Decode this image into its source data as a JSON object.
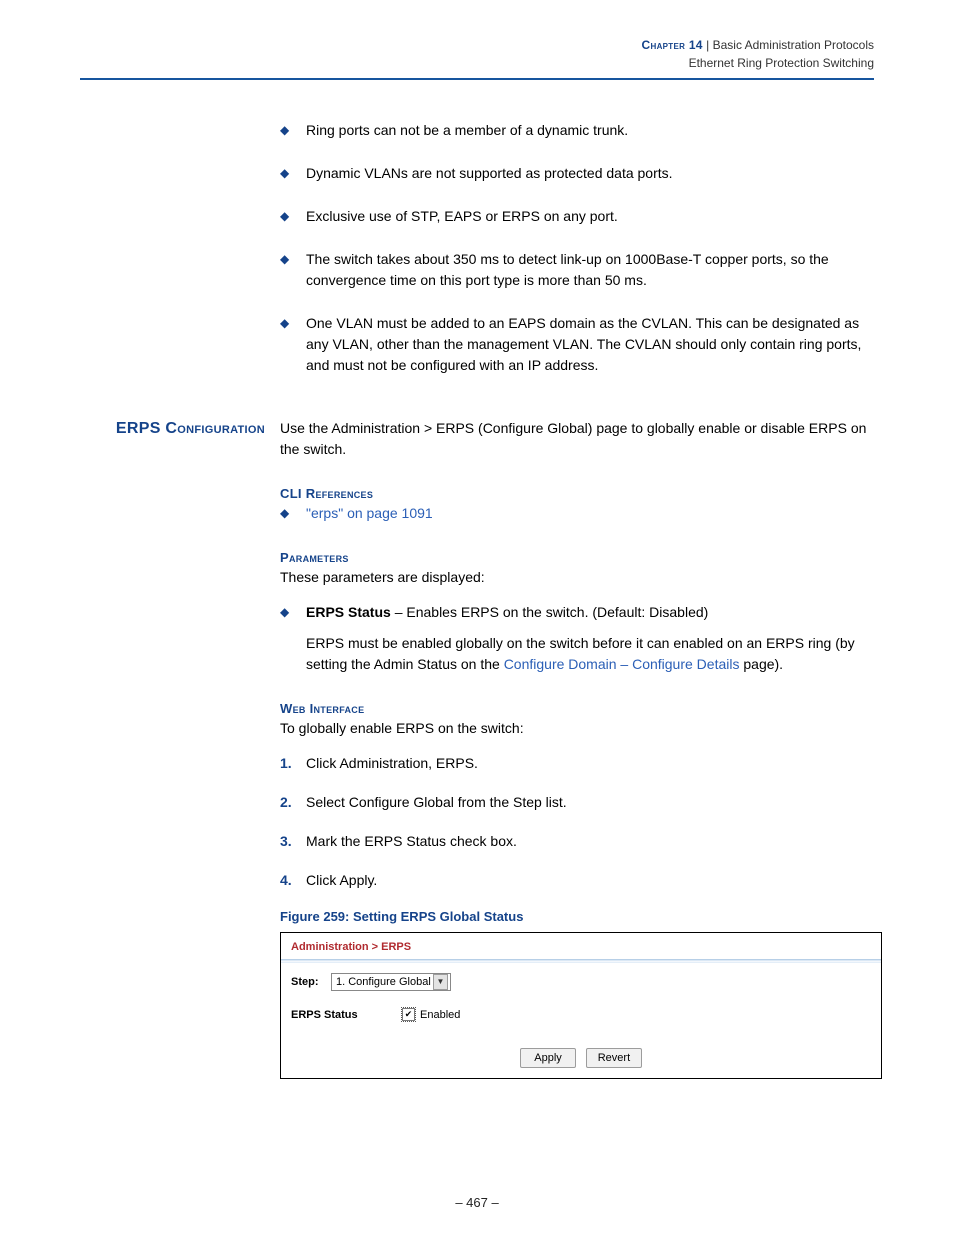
{
  "header": {
    "chapter": "Chapter 14",
    "sep": "  |  ",
    "title": "Basic Administration Protocols",
    "subtitle": "Ethernet Ring Protection Switching"
  },
  "intro_bullets": [
    "Ring ports can not be a member of a dynamic trunk.",
    "Dynamic VLANs are not supported as protected data ports.",
    "Exclusive use of STP, EAPS or ERPS on any port.",
    "The switch takes about 350 ms to detect link-up on 1000Base-T copper ports, so the convergence time on this port type is more than 50 ms.",
    "One VLAN must be added to an EAPS domain as the CVLAN. This can be designated as any VLAN, other than the management VLAN. The CVLAN should only contain ring ports, and must not be configured with an IP address."
  ],
  "section": {
    "sidehead": "ERPS Configuration",
    "intro": "Use the Administration > ERPS (Configure Global) page to globally enable or disable ERPS on the switch.",
    "cli_head": "CLI References",
    "cli_link": "\"erps\" on page 1091",
    "params_head": "Parameters",
    "params_intro": "These parameters are displayed:",
    "param_bold": "ERPS Status",
    "param_text": " – Enables ERPS on the switch. (Default: Disabled)",
    "param_note_a": "ERPS must be enabled globally on the switch before it can enabled on an ERPS ring (by setting the Admin Status on the ",
    "param_note_link": "Configure Domain – Configure Details",
    "param_note_b": " page).",
    "web_head": "Web Interface",
    "web_intro": "To globally enable ERPS on the switch:",
    "steps": [
      "Click Administration, ERPS.",
      "Select Configure Global from the Step list.",
      "Mark the ERPS Status check box.",
      "Click Apply."
    ],
    "figure_caption": "Figure 259:  Setting ERPS Global Status"
  },
  "panel": {
    "breadcrumb": "Administration > ERPS",
    "step_label": "Step:",
    "step_value": "1. Configure Global",
    "field_label": "ERPS Status",
    "check_label": "Enabled",
    "apply": "Apply",
    "revert": "Revert"
  },
  "page_number": "–  467  –"
}
